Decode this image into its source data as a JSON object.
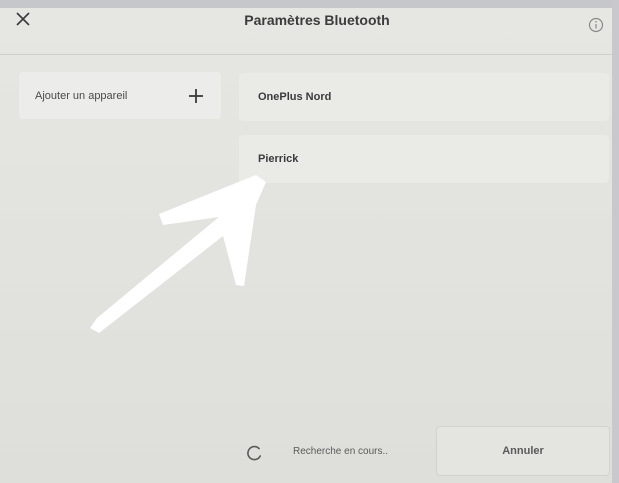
{
  "header": {
    "title": "Paramètres Bluetooth",
    "close_icon": "close-icon",
    "info_icon": "info-icon"
  },
  "sidebar": {
    "add_device_label": "Ajouter un appareil",
    "add_icon": "plus-icon"
  },
  "devices": [
    {
      "name": "OnePlus Nord"
    },
    {
      "name": "Pierrick"
    }
  ],
  "footer": {
    "status_text": "Recherche en cours..",
    "spinner_icon": "loading-spinner-icon",
    "cancel_label": "Annuler"
  },
  "annotation": {
    "icon": "hand-drawn-arrow",
    "color": "#ffffff"
  }
}
